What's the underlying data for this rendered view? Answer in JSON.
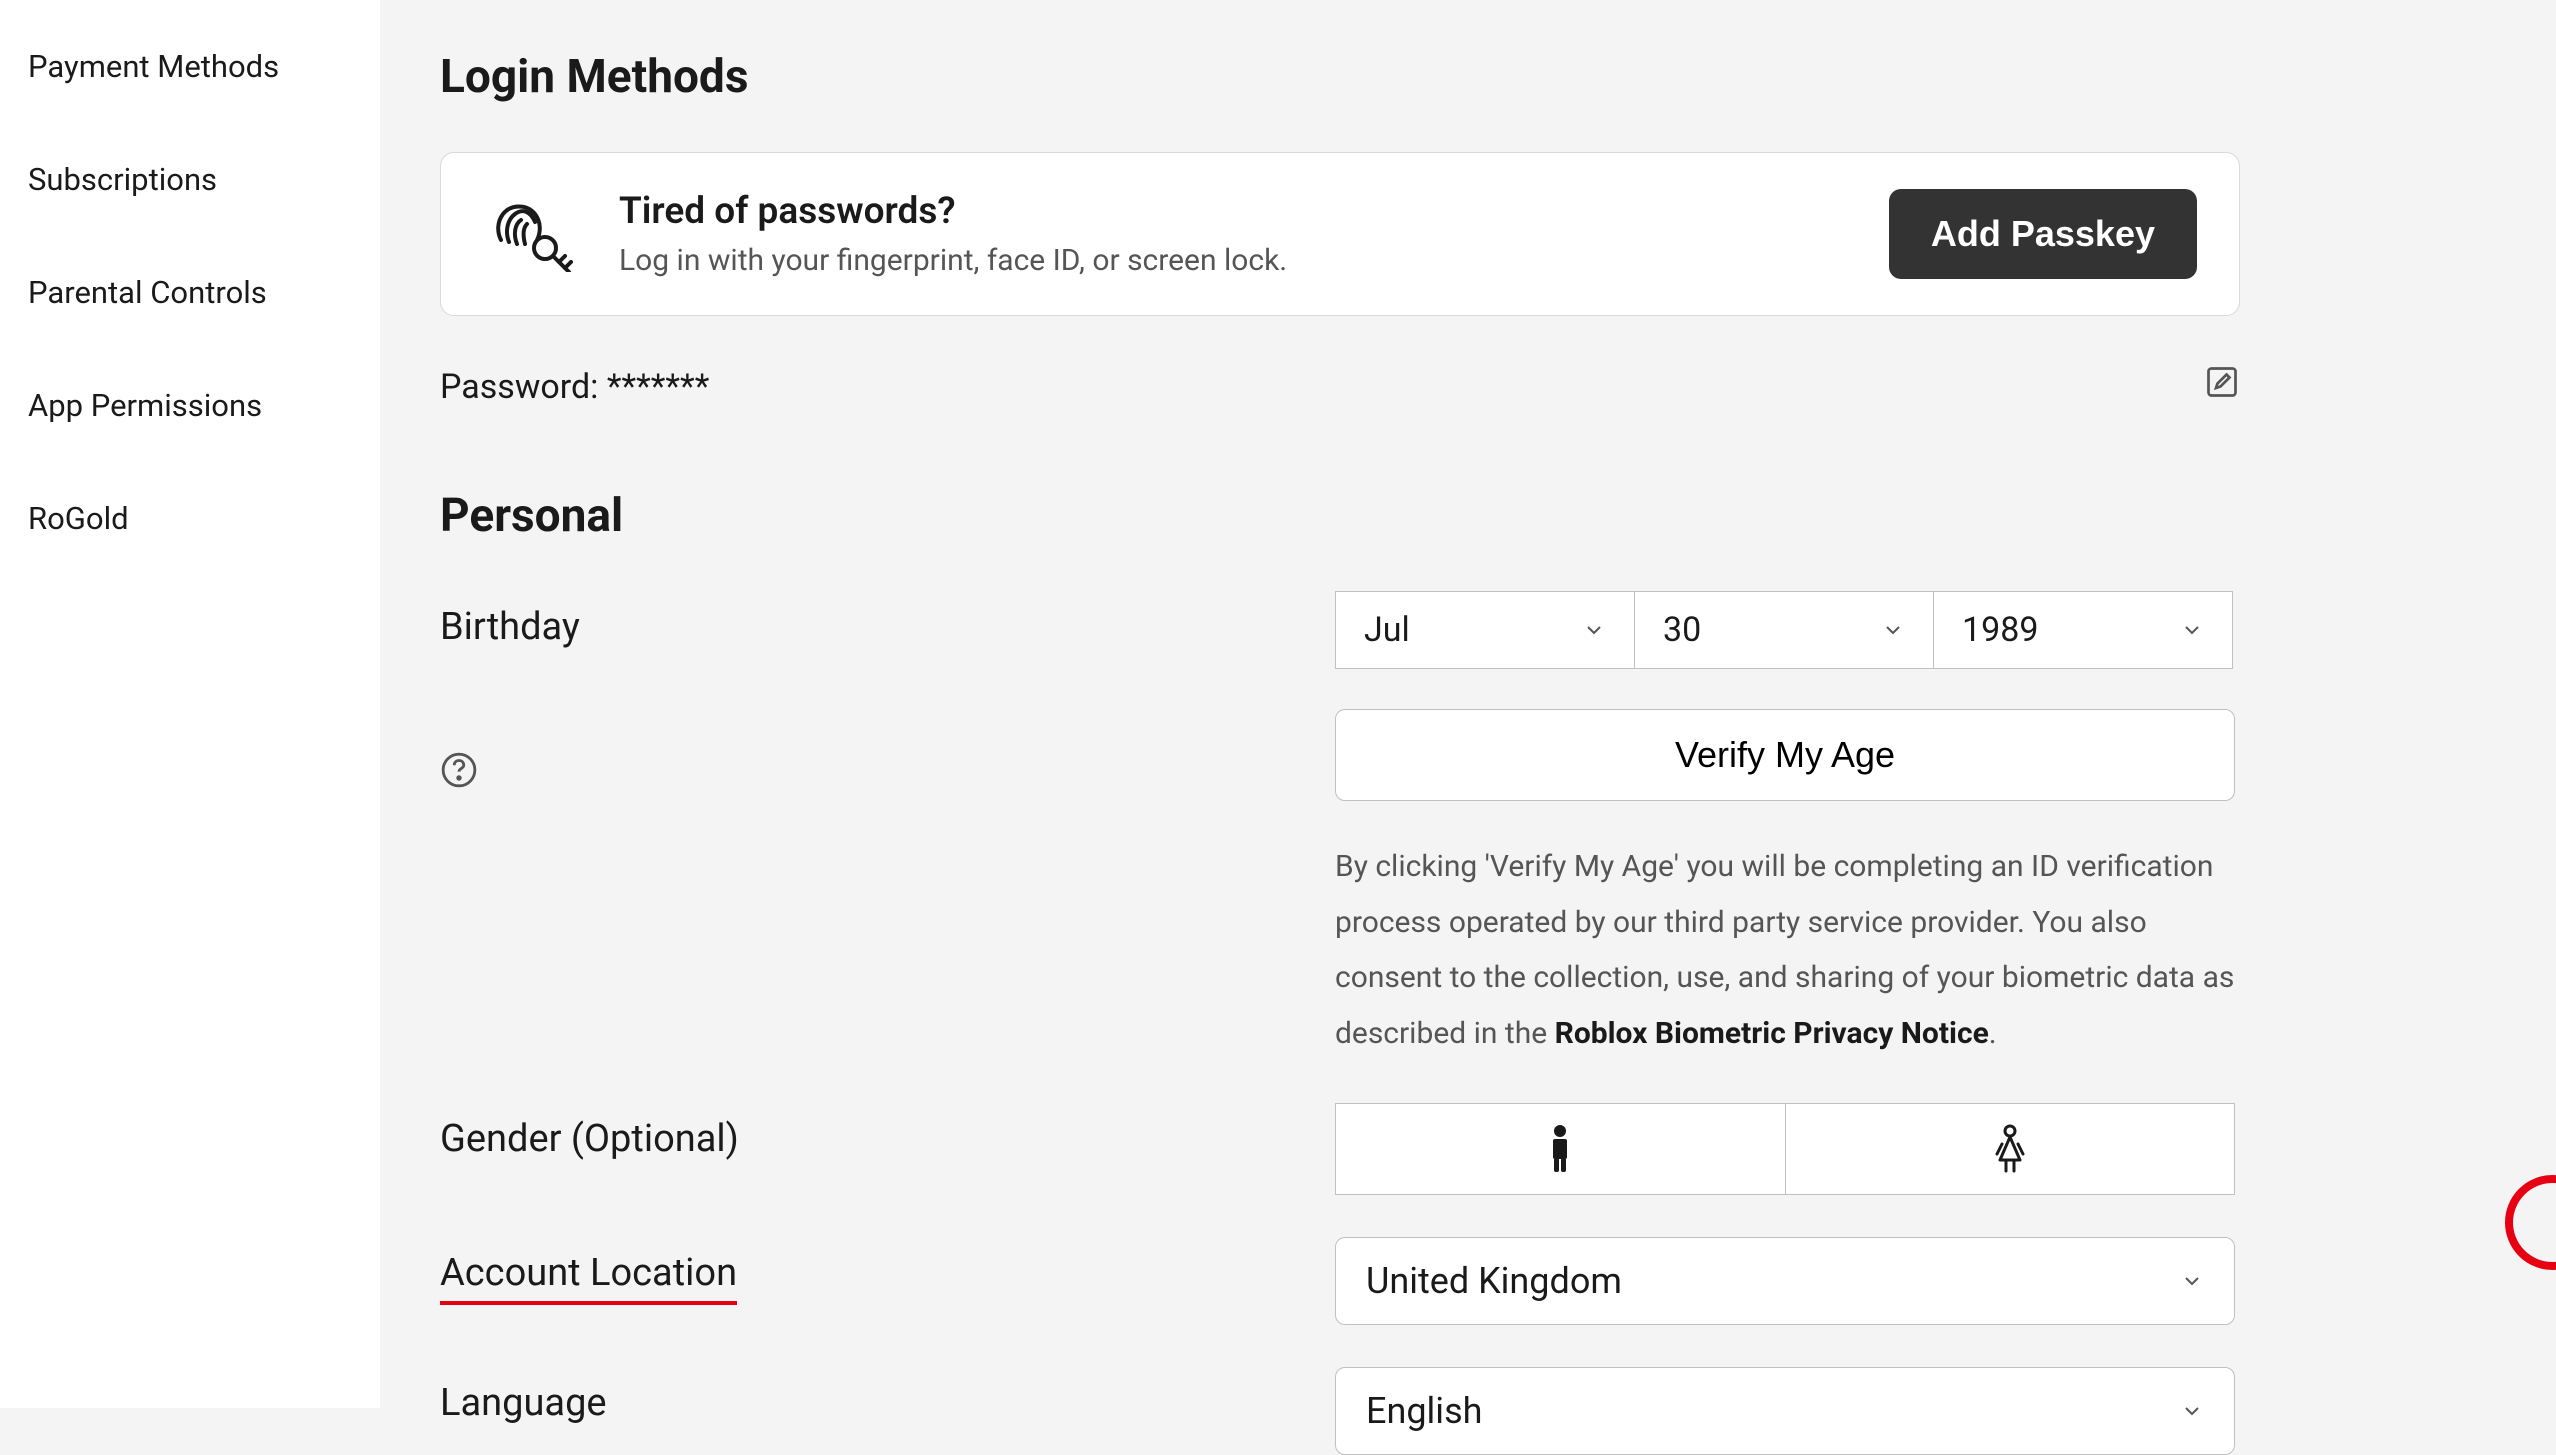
{
  "sidebar": {
    "items": [
      {
        "label": "Payment Methods"
      },
      {
        "label": "Subscriptions"
      },
      {
        "label": "Parental Controls"
      },
      {
        "label": "App Permissions"
      },
      {
        "label": "RoGold"
      }
    ]
  },
  "sections": {
    "login_methods_title": "Login Methods",
    "personal_title": "Personal"
  },
  "passkey": {
    "title": "Tired of passwords?",
    "description": "Log in with your fingerprint, face ID, or screen lock.",
    "button": "Add Passkey"
  },
  "password": {
    "label": "Password: *******"
  },
  "birthday": {
    "label": "Birthday",
    "month": "Jul",
    "day": "30",
    "year": "1989"
  },
  "verify": {
    "button": "Verify My Age",
    "description_part1": "By clicking 'Verify My Age' you will be completing an ID verification process operated by our third party service provider. You also consent to the collection, use, and sharing of your biometric data as described in the ",
    "notice_link": "Roblox Biometric Privacy Notice",
    "description_part2": "."
  },
  "gender": {
    "label": "Gender (Optional)"
  },
  "location": {
    "label": "Account Location",
    "value": "United Kingdom"
  },
  "language": {
    "label": "Language",
    "value": "English"
  }
}
